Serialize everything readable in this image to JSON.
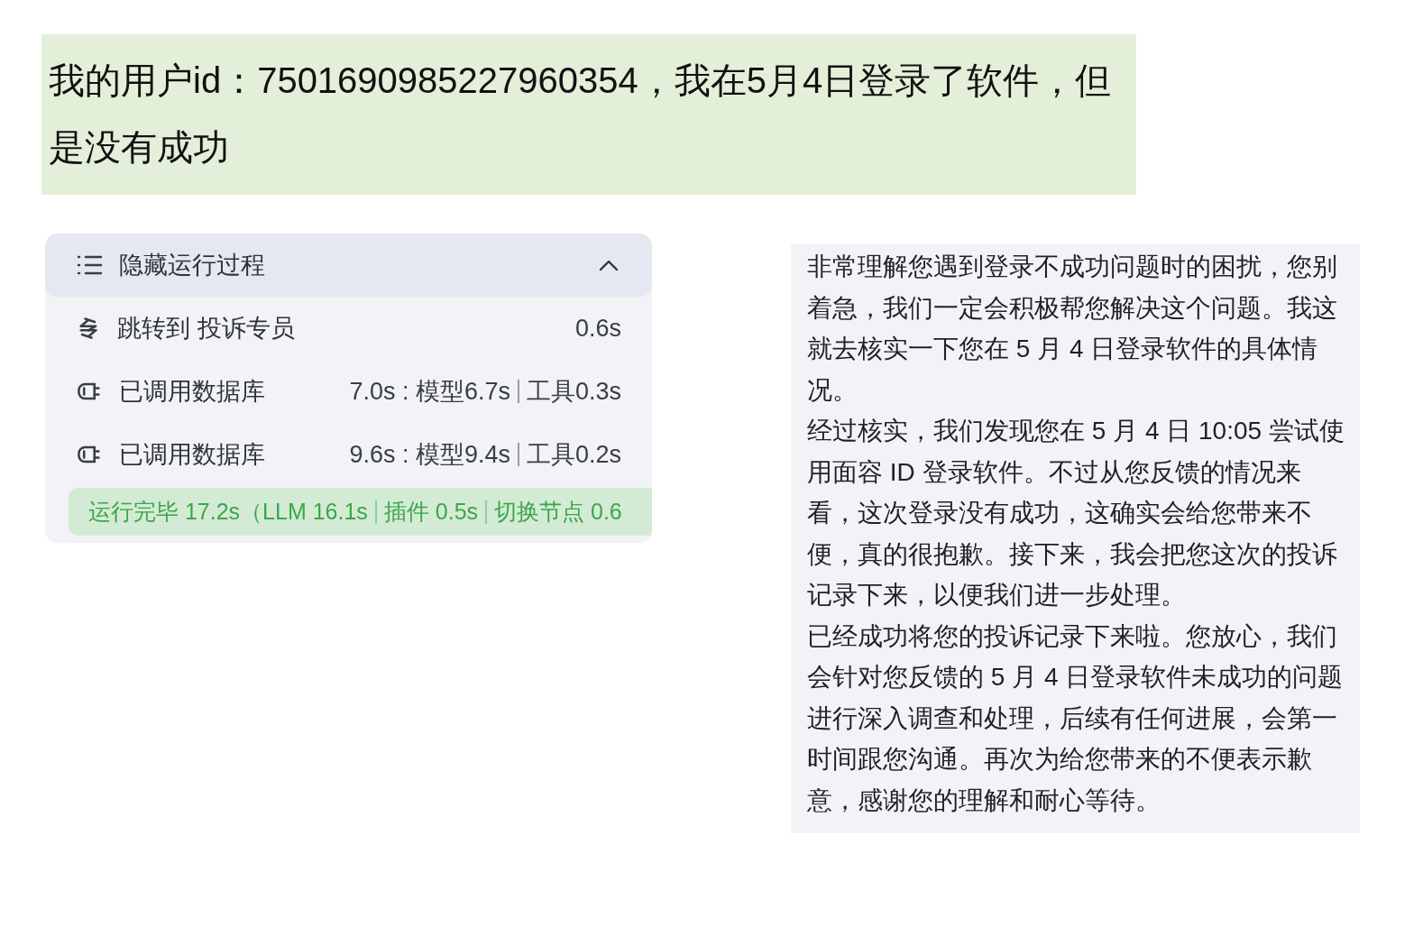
{
  "user_message": {
    "text": "我的用户id：7501690985227960354，我在5月4日登录了软件，但是没有成功"
  },
  "process_panel": {
    "header": {
      "label": "隐藏运行过程",
      "expanded": true
    },
    "steps": [
      {
        "kind": "handoff",
        "label": "跳转到 投诉专员",
        "timing_parts": [
          "0.6s"
        ]
      },
      {
        "kind": "plugin",
        "label": "已调用数据库",
        "timing_parts": [
          "7.0s : 模型6.7s",
          "工具0.3s"
        ]
      },
      {
        "kind": "plugin",
        "label": "已调用数据库",
        "timing_parts": [
          "9.6s : 模型9.4s",
          "工具0.2s"
        ]
      }
    ],
    "status": {
      "parts": [
        "运行完毕 17.2s（LLM 16.1s",
        "插件 0.5s",
        "切换节点 0.6"
      ]
    }
  },
  "reply": {
    "paragraphs": [
      "非常理解您遇到登录不成功问题时的困扰，您别着急，我们一定会积极帮您解决这个问题。我这就去核实一下您在 5 月 4 日登录软件的具体情况。",
      "经过核实，我们发现您在 5 月 4 日 10:05 尝试使用面容 ID 登录软件。不过从您反馈的情况来看，这次登录没有成功，这确实会给您带来不便，真的很抱歉。接下来，我会把您这次的投诉记录下来，以便我们进一步处理。",
      "已经成功将您的投诉记录下来啦。您放心，我们会针对您反馈的 5 月 4 日登录软件未成功的问题进行深入调查和处理，后续有任何进展，会第一时间跟您沟通。再次为给您带来的不便表示歉意，感谢您的理解和耐心等待。"
    ]
  }
}
